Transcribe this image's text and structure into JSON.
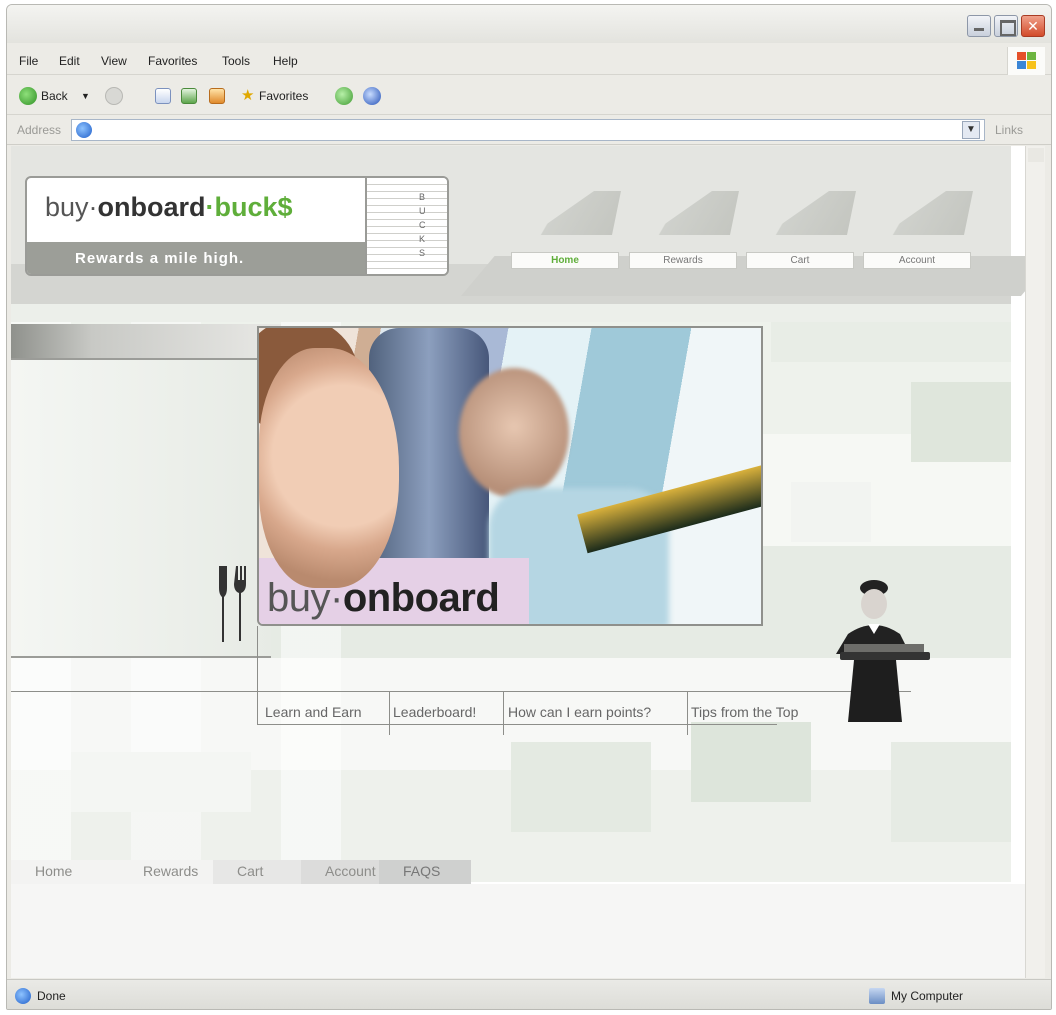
{
  "browser": {
    "menu": [
      "File",
      "Edit",
      "View",
      "Favorites",
      "Tools",
      "Help"
    ],
    "toolbar": {
      "back_label": "Back",
      "favorites_label": "Favorites"
    },
    "address": {
      "label": "Address",
      "value": "",
      "links_label": "Links"
    },
    "status": {
      "left_text": "Done",
      "zone_text": "My Computer"
    }
  },
  "site": {
    "logo": {
      "part1": "buy·",
      "part2": "onboard",
      "part3": "·buck$",
      "tagline": "Rewards a mile high.",
      "ticket_text": "BUCKS"
    },
    "top_nav": [
      "Home",
      "Rewards",
      "Cart",
      "Account"
    ],
    "top_nav_active": "Home",
    "brand": {
      "light": "buy·",
      "bold": "onboard"
    },
    "sub_nav": [
      "Learn  and Earn",
      "Leaderboard!",
      "How can I earn points?",
      "Tips from the Top"
    ],
    "bottom_nav": [
      "Home",
      "Rewards",
      "Cart",
      "Account",
      "FAQS"
    ]
  },
  "colors": {
    "accent_green": "#5fae3a",
    "chrome_bg": "#ecebe6",
    "close_red": "#d24b2b"
  },
  "icons": [
    "close-icon",
    "maximize-icon",
    "minimize-icon",
    "windows-logo-icon",
    "back-icon",
    "forward-icon",
    "stop-icon",
    "refresh-icon",
    "home-icon",
    "favorites-star-icon",
    "media-icon",
    "history-icon",
    "ie-icon",
    "fork-knife-icon",
    "computer-icon"
  ]
}
